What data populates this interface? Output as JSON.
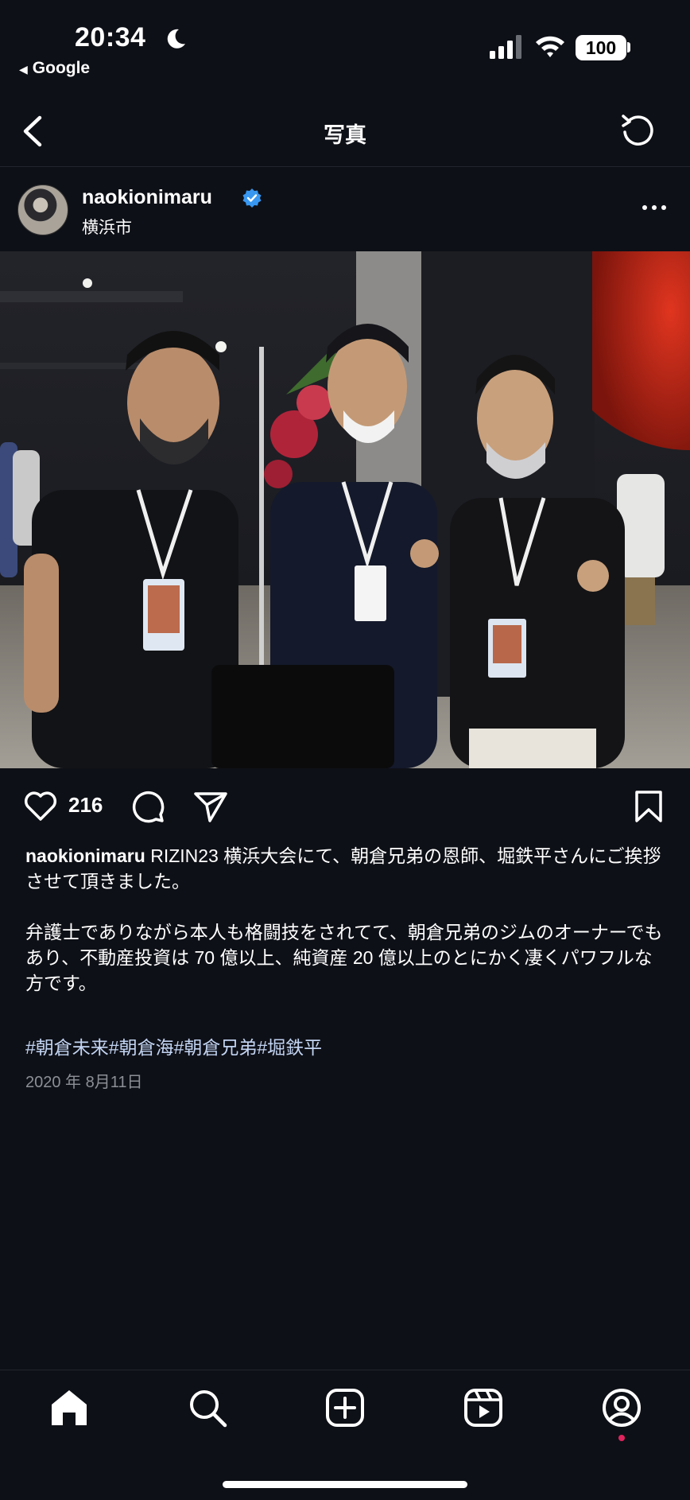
{
  "status_bar": {
    "time": "20:34",
    "back_app": "Google",
    "battery": "100"
  },
  "header": {
    "title": "写真"
  },
  "post": {
    "username": "naokionimaru",
    "location": "横浜市",
    "verified": true,
    "likes": "216",
    "caption_user": "naokionimaru",
    "caption_line1": "RIZIN23 横浜大会にて、朝倉兄弟の恩師、堀鉄平さんにご挨拶させて頂きました。",
    "caption_para2": "弁護士でありながら本人も格闘技をされてて、朝倉兄弟のジムのオーナーでもあり、不動産投資は 70 億以上、純資産 20 億以上のとにかく凄くパワフルな方です。",
    "hashtags": "#朝倉未来#朝倉海#朝倉兄弟#堀鉄平",
    "date": "2020 年 8月11日"
  },
  "tabbar": {
    "items": [
      "home-icon",
      "search-icon",
      "create-icon",
      "reels-icon",
      "profile-icon"
    ]
  },
  "colors": {
    "background": "#0e1017",
    "hashtag": "#c2d4f2",
    "verified": "#3897f0",
    "notification_dot": "#e0245e"
  }
}
